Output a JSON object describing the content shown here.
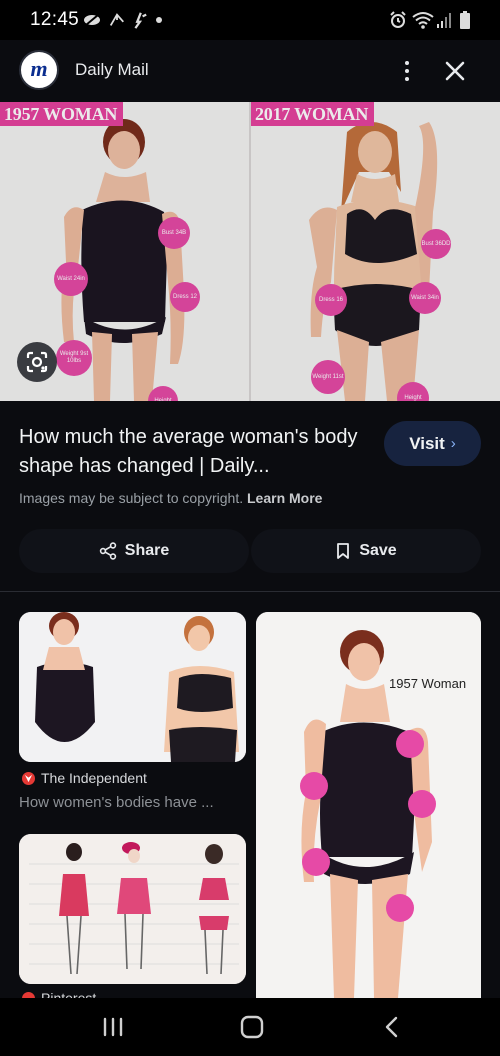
{
  "status_bar": {
    "time": "12:45"
  },
  "header": {
    "source_logo_letter": "m",
    "source_name": "Daily Mail"
  },
  "hero": {
    "left_tag": "1957 WOMAN",
    "right_tag": "2017 WOMAN",
    "left_bubbles": [
      "Bust 34B",
      "Waist 24in",
      "Dress 12",
      "Weight 9st 10lbs",
      "Height"
    ],
    "right_bubbles": [
      "Bust 36DD",
      "Dress 16",
      "Waist 34in",
      "Weight 11st",
      "Height"
    ]
  },
  "result": {
    "title": "How much the average woman's body shape has changed | Daily...",
    "visit_label": "Visit",
    "copyright_text": "Images may be subject to copyright.",
    "learn_more_label": "Learn More",
    "share_label": "Share",
    "save_label": "Save"
  },
  "related": {
    "card1": {
      "source": "The Independent",
      "title": "How women's bodies have ..."
    },
    "card2": {
      "label": "1957 Woman"
    },
    "card3": {
      "source": "Pinterest"
    }
  },
  "colors": {
    "background": "#0b0c10",
    "accent_pink": "#e64aa6",
    "link_blue": "#8ab4f8",
    "visit_bg": "#17233f"
  },
  "icons": [
    "silent-icon",
    "share-status-icon",
    "download-icon",
    "alarm-icon",
    "wifi-icon",
    "signal-icon",
    "battery-icon",
    "more-vert-icon",
    "close-icon",
    "lens-icon",
    "share-icon",
    "bookmark-icon",
    "chevron-right-icon",
    "recents-icon",
    "home-icon",
    "back-icon"
  ]
}
